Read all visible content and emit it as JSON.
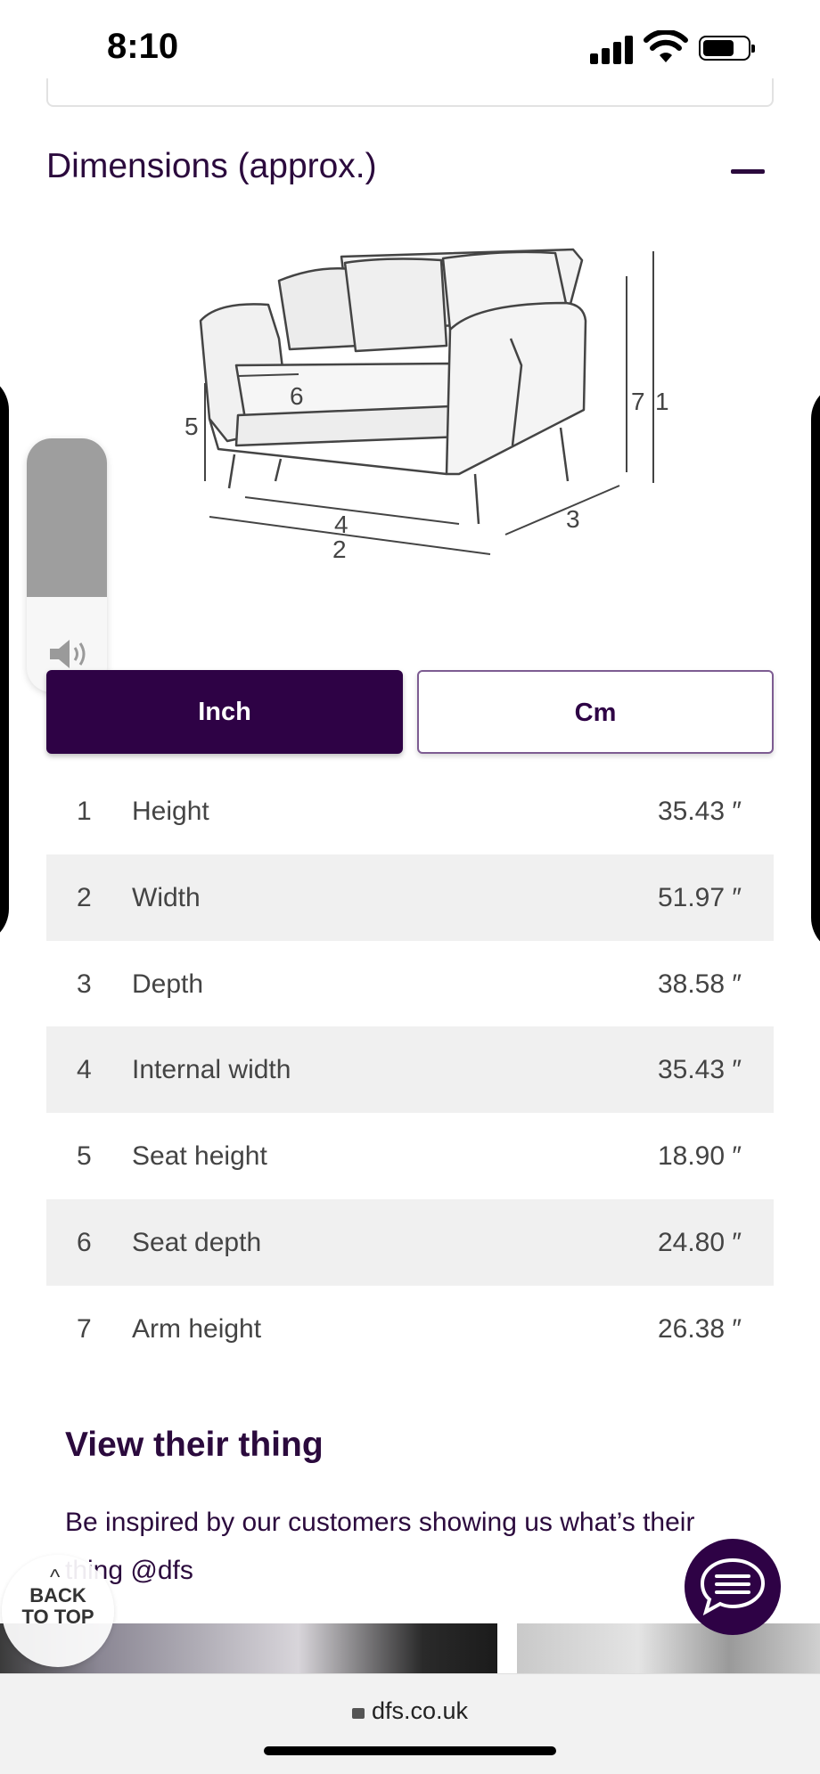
{
  "status_bar": {
    "time": "8:10"
  },
  "section": {
    "title": "Dimensions (approx.)"
  },
  "diagram_labels": [
    "1",
    "2",
    "3",
    "4",
    "5",
    "6",
    "7"
  ],
  "unit_toggle": {
    "inch": "Inch",
    "cm": "Cm",
    "selected": "Inch"
  },
  "dimensions": [
    {
      "num": "1",
      "label": "Height",
      "value": "35.43 ″"
    },
    {
      "num": "2",
      "label": "Width",
      "value": "51.97 ″"
    },
    {
      "num": "3",
      "label": "Depth",
      "value": "38.58 ″"
    },
    {
      "num": "4",
      "label": "Internal width",
      "value": "35.43 ″"
    },
    {
      "num": "5",
      "label": "Seat height",
      "value": "18.90 ″"
    },
    {
      "num": "6",
      "label": "Seat depth",
      "value": "24.80 ″"
    },
    {
      "num": "7",
      "label": "Arm height",
      "value": "26.38 ″"
    }
  ],
  "ugc": {
    "title": "View their thing",
    "text": "Be inspired by our customers showing us what’s their thing @dfs"
  },
  "back_to_top": {
    "line1": "BACK",
    "line2": "TO TOP"
  },
  "browser": {
    "url": "dfs.co.uk"
  },
  "colors": {
    "brand": "#2e0245",
    "row_alt": "#f0f0f0"
  },
  "icons": [
    "signal-icon",
    "wifi-icon",
    "battery-icon",
    "minus-icon",
    "speaker-icon",
    "chat-icon",
    "lock-icon",
    "caret-up-icon"
  ]
}
